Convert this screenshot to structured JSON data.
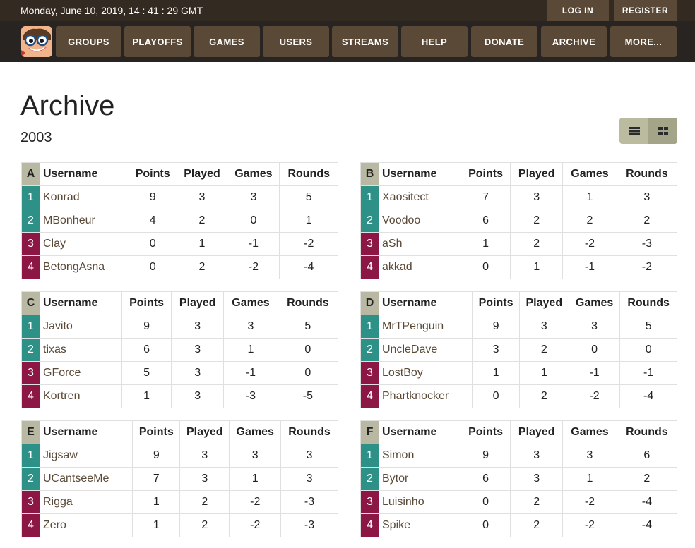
{
  "header": {
    "datetime": "Monday, June 10, 2019,  14 : 41 : 29 GMT",
    "login_label": "LOG IN",
    "register_label": "REGISTER"
  },
  "nav": {
    "items": [
      "GROUPS",
      "PLAYOFFS",
      "GAMES",
      "USERS",
      "STREAMS",
      "HELP",
      "DONATE",
      "ARCHIVE",
      "MORE..."
    ]
  },
  "page": {
    "title": "Archive",
    "subtitle": "2003"
  },
  "view_toggle": {
    "icons": [
      "list-icon",
      "grid-icon"
    ]
  },
  "columns": [
    "Username",
    "Points",
    "Played",
    "Games",
    "Rounds"
  ],
  "colors": {
    "advance": "#2e9187",
    "eliminated": "#8c1744",
    "header_bar": "#332a22",
    "nav_button": "#5a4936"
  },
  "groups": [
    {
      "letter": "A",
      "rows": [
        {
          "pos": "1",
          "user": "Konrad",
          "points": "9",
          "played": "3",
          "games": "3",
          "rounds": "5"
        },
        {
          "pos": "2",
          "user": "MBonheur",
          "points": "4",
          "played": "2",
          "games": "0",
          "rounds": "1"
        },
        {
          "pos": "3",
          "user": "Clay",
          "points": "0",
          "played": "1",
          "games": "-1",
          "rounds": "-2"
        },
        {
          "pos": "4",
          "user": "BetongAsna",
          "points": "0",
          "played": "2",
          "games": "-2",
          "rounds": "-4"
        }
      ]
    },
    {
      "letter": "B",
      "rows": [
        {
          "pos": "1",
          "user": "Xaositect",
          "points": "7",
          "played": "3",
          "games": "1",
          "rounds": "3"
        },
        {
          "pos": "2",
          "user": "Voodoo",
          "points": "6",
          "played": "2",
          "games": "2",
          "rounds": "2"
        },
        {
          "pos": "3",
          "user": "aSh",
          "points": "1",
          "played": "2",
          "games": "-2",
          "rounds": "-3"
        },
        {
          "pos": "4",
          "user": "akkad",
          "points": "0",
          "played": "1",
          "games": "-1",
          "rounds": "-2"
        }
      ]
    },
    {
      "letter": "C",
      "rows": [
        {
          "pos": "1",
          "user": "Javito",
          "points": "9",
          "played": "3",
          "games": "3",
          "rounds": "5"
        },
        {
          "pos": "2",
          "user": "tixas",
          "points": "6",
          "played": "3",
          "games": "1",
          "rounds": "0"
        },
        {
          "pos": "3",
          "user": "GForce",
          "points": "5",
          "played": "3",
          "games": "-1",
          "rounds": "0"
        },
        {
          "pos": "4",
          "user": "Kortren",
          "points": "1",
          "played": "3",
          "games": "-3",
          "rounds": "-5"
        }
      ]
    },
    {
      "letter": "D",
      "rows": [
        {
          "pos": "1",
          "user": "MrTPenguin",
          "points": "9",
          "played": "3",
          "games": "3",
          "rounds": "5"
        },
        {
          "pos": "2",
          "user": "UncleDave",
          "points": "3",
          "played": "2",
          "games": "0",
          "rounds": "0"
        },
        {
          "pos": "3",
          "user": "LostBoy",
          "points": "1",
          "played": "1",
          "games": "-1",
          "rounds": "-1"
        },
        {
          "pos": "4",
          "user": "Phartknocker",
          "points": "0",
          "played": "2",
          "games": "-2",
          "rounds": "-4"
        }
      ]
    },
    {
      "letter": "E",
      "rows": [
        {
          "pos": "1",
          "user": "Jigsaw",
          "points": "9",
          "played": "3",
          "games": "3",
          "rounds": "3"
        },
        {
          "pos": "2",
          "user": "UCantseeMe",
          "points": "7",
          "played": "3",
          "games": "1",
          "rounds": "3"
        },
        {
          "pos": "3",
          "user": "Rigga",
          "points": "1",
          "played": "2",
          "games": "-2",
          "rounds": "-3"
        },
        {
          "pos": "4",
          "user": "Zero",
          "points": "1",
          "played": "2",
          "games": "-2",
          "rounds": "-3"
        }
      ]
    },
    {
      "letter": "F",
      "rows": [
        {
          "pos": "1",
          "user": "Simon",
          "points": "9",
          "played": "3",
          "games": "3",
          "rounds": "6"
        },
        {
          "pos": "2",
          "user": "Bytor",
          "points": "6",
          "played": "3",
          "games": "1",
          "rounds": "2"
        },
        {
          "pos": "3",
          "user": "Luisinho",
          "points": "0",
          "played": "2",
          "games": "-2",
          "rounds": "-4"
        },
        {
          "pos": "4",
          "user": "Spike",
          "points": "0",
          "played": "2",
          "games": "-2",
          "rounds": "-4"
        }
      ]
    }
  ]
}
